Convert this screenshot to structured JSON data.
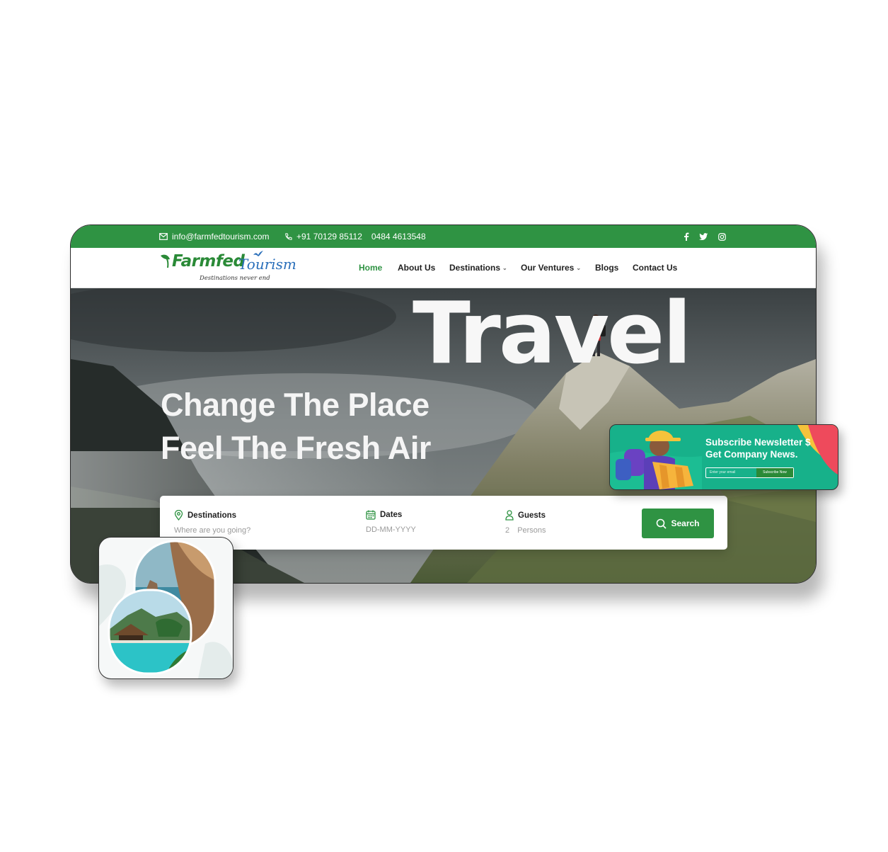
{
  "topbar": {
    "email": "info@farmfedtourism.com",
    "phone": "+91 70129 85112",
    "phone2": "0484 4613548",
    "social": [
      "facebook-icon",
      "twitter-icon",
      "instagram-icon"
    ]
  },
  "brand": {
    "name_part1": "Farmfed",
    "name_part2": "Tourism",
    "tagline": "Destinations never end"
  },
  "nav": {
    "items": [
      {
        "label": "Home",
        "active": true
      },
      {
        "label": "About Us"
      },
      {
        "label": "Destinations",
        "dropdown": true
      },
      {
        "label": "Our Ventures",
        "dropdown": true
      },
      {
        "label": "Blogs"
      },
      {
        "label": "Contact Us"
      }
    ]
  },
  "hero": {
    "big_word": "Travel",
    "headline_line1": "Change The Place",
    "headline_line2": "Feel The Fresh Air"
  },
  "search": {
    "destinations": {
      "label": "Destinations",
      "placeholder": "Where are you going?"
    },
    "dates": {
      "label": "Dates",
      "placeholder": "DD-MM-YYYY"
    },
    "guests": {
      "label": "Guests",
      "count": "2",
      "unit": "Persons"
    },
    "button": "Search"
  },
  "newsletter": {
    "title_line1": "Subscribe Newsletter $",
    "title_line2": "Get Company News.",
    "email_placeholder": "Enter your email",
    "button": "Subscribe Now"
  },
  "colors": {
    "brand_green": "#2f9343",
    "logo_blue": "#2a6fba",
    "newsletter_teal": "#17b18a"
  }
}
